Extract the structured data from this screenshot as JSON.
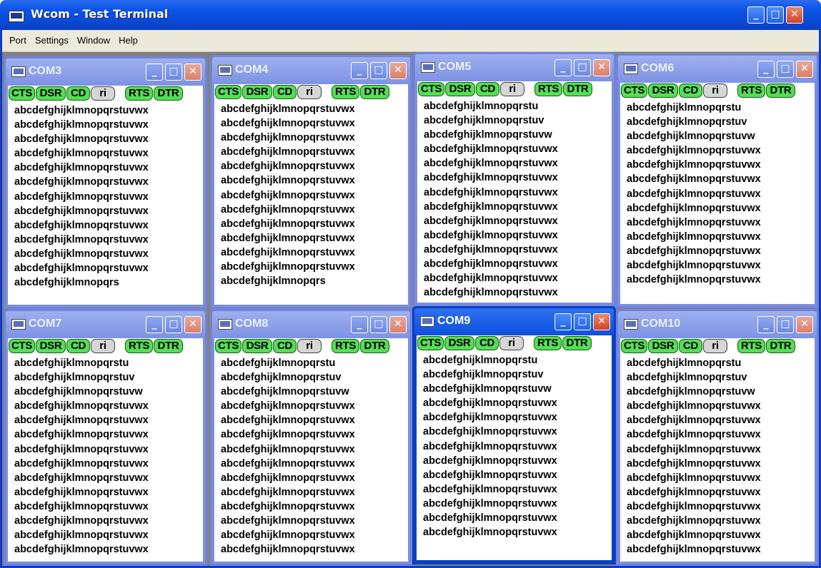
{
  "window": {
    "title": "Wcom - Test Terminal",
    "minimize": "_",
    "maximize": "□",
    "close": "✕"
  },
  "menu": [
    "Port",
    "Settings",
    "Window",
    "Help"
  ],
  "signals": [
    "CTS",
    "DSR",
    "CD",
    "ri",
    "RTS",
    "DTR"
  ],
  "terminals": [
    {
      "name": "COM3",
      "lines": [
        "abcdefghijklmnopqrstuvwx",
        "abcdefghijklmnopqrstuvwx",
        "abcdefghijklmnopqrstuvwx",
        "abcdefghijklmnopqrstuvwx",
        "abcdefghijklmnopqrstuvwx",
        "abcdefghijklmnopqrstuvwx",
        "abcdefghijklmnopqrstuvwx",
        "abcdefghijklmnopqrstuvwx",
        "abcdefghijklmnopqrstuvwx",
        "abcdefghijklmnopqrstuvwx",
        "abcdefghijklmnopqrstuvwx",
        "abcdefghijklmnopqrstuvwx",
        "abcdefghijklmnopqrs"
      ]
    },
    {
      "name": "COM4",
      "lines": [
        "abcdefghijklmnopqrstuvwx",
        "abcdefghijklmnopqrstuvwx",
        "abcdefghijklmnopqrstuvwx",
        "abcdefghijklmnopqrstuvwx",
        "abcdefghijklmnopqrstuvwx",
        "abcdefghijklmnopqrstuvwx",
        "abcdefghijklmnopqrstuvwx",
        "abcdefghijklmnopqrstuvwx",
        "abcdefghijklmnopqrstuvwx",
        "abcdefghijklmnopqrstuvwx",
        "abcdefghijklmnopqrstuvwx",
        "abcdefghijklmnopqrstuvwx",
        "abcdefghijklmnopqrs"
      ]
    },
    {
      "name": "COM5",
      "lines": [
        "abcdefghijklmnopqrstu",
        "abcdefghijklmnopqrstuv",
        "abcdefghijklmnopqrstuvw",
        "abcdefghijklmnopqrstuvwx",
        "abcdefghijklmnopqrstuvwx",
        "abcdefghijklmnopqrstuvwx",
        "abcdefghijklmnopqrstuvwx",
        "abcdefghijklmnopqrstuvwx",
        "abcdefghijklmnopqrstuvwx",
        "abcdefghijklmnopqrstuvwx",
        "abcdefghijklmnopqrstuvwx",
        "abcdefghijklmnopqrstuvwx",
        "abcdefghijklmnopqrstuvwx",
        "abcdefghijklmnopqrstuvwx"
      ]
    },
    {
      "name": "COM6",
      "lines": [
        "abcdefghijklmnopqrstu",
        "abcdefghijklmnopqrstuv",
        "abcdefghijklmnopqrstuvw",
        "abcdefghijklmnopqrstuvwx",
        "abcdefghijklmnopqrstuvwx",
        "abcdefghijklmnopqrstuvwx",
        "abcdefghijklmnopqrstuvwx",
        "abcdefghijklmnopqrstuvwx",
        "abcdefghijklmnopqrstuvwx",
        "abcdefghijklmnopqrstuvwx",
        "abcdefghijklmnopqrstuvwx",
        "abcdefghijklmnopqrstuvwx",
        "abcdefghijklmnopqrstuvwx"
      ]
    },
    {
      "name": "COM7",
      "lines": [
        "abcdefghijklmnopqrstu",
        "abcdefghijklmnopqrstuv",
        "abcdefghijklmnopqrstuvw",
        "abcdefghijklmnopqrstuvwx",
        "abcdefghijklmnopqrstuvwx",
        "abcdefghijklmnopqrstuvwx",
        "abcdefghijklmnopqrstuvwx",
        "abcdefghijklmnopqrstuvwx",
        "abcdefghijklmnopqrstuvwx",
        "abcdefghijklmnopqrstuvwx",
        "abcdefghijklmnopqrstuvwx",
        "abcdefghijklmnopqrstuvwx",
        "abcdefghijklmnopqrstuvwx",
        "abcdefghijklmnopqrstuvwx"
      ]
    },
    {
      "name": "COM8",
      "lines": [
        "abcdefghijklmnopqrstu",
        "abcdefghijklmnopqrstuv",
        "abcdefghijklmnopqrstuvw",
        "abcdefghijklmnopqrstuvwx",
        "abcdefghijklmnopqrstuvwx",
        "abcdefghijklmnopqrstuvwx",
        "abcdefghijklmnopqrstuvwx",
        "abcdefghijklmnopqrstuvwx",
        "abcdefghijklmnopqrstuvwx",
        "abcdefghijklmnopqrstuvwx",
        "abcdefghijklmnopqrstuvwx",
        "abcdefghijklmnopqrstuvwx",
        "abcdefghijklmnopqrstuvwx",
        "abcdefghijklmnopqrstuvwx"
      ]
    },
    {
      "name": "COM9",
      "lines": [
        "abcdefghijklmnopqrstu",
        "abcdefghijklmnopqrstuv",
        "abcdefghijklmnopqrstuvw",
        "abcdefghijklmnopqrstuvwx",
        "abcdefghijklmnopqrstuvwx",
        "abcdefghijklmnopqrstuvwx",
        "abcdefghijklmnopqrstuvwx",
        "abcdefghijklmnopqrstuvwx",
        "abcdefghijklmnopqrstuvwx",
        "abcdefghijklmnopqrstuvwx",
        "abcdefghijklmnopqrstuvwx",
        "abcdefghijklmnopqrstuvwx",
        "abcdefghijklmnopqrstuvwx"
      ]
    },
    {
      "name": "COM10",
      "lines": [
        "abcdefghijklmnopqrstu",
        "abcdefghijklmnopqrstuv",
        "abcdefghijklmnopqrstuvw",
        "abcdefghijklmnopqrstuvwx",
        "abcdefghijklmnopqrstuvwx",
        "abcdefghijklmnopqrstuvwx",
        "abcdefghijklmnopqrstuvwx",
        "abcdefghijklmnopqrstuvwx",
        "abcdefghijklmnopqrstuvwx",
        "abcdefghijklmnopqrstuvwx",
        "abcdefghijklmnopqrstuvwx",
        "abcdefghijklmnopqrstuvwx",
        "abcdefghijklmnopqrstuvwx",
        "abcdefghijklmnopqrstuvwx"
      ]
    }
  ]
}
